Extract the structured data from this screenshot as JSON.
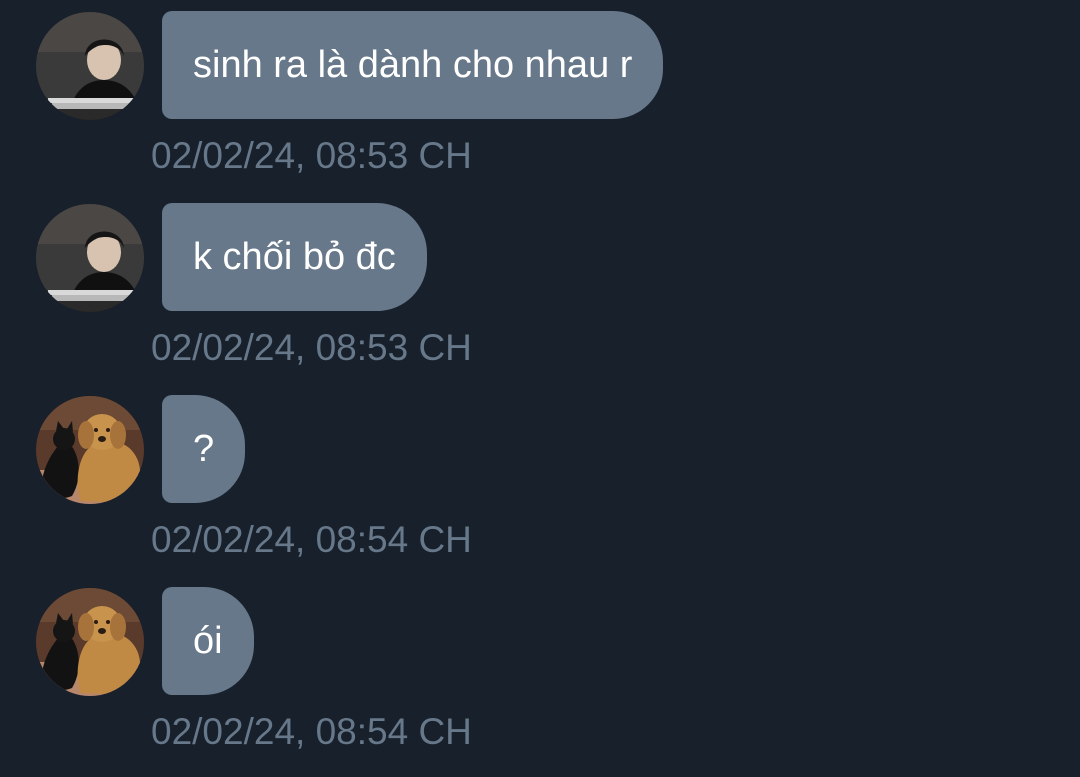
{
  "conversation": {
    "messages": [
      {
        "sender_avatar": "person-at-desk-avatar",
        "text": "sinh ra là dành cho nhau r",
        "timestamp": "02/02/24, 08:53 CH"
      },
      {
        "sender_avatar": "person-at-desk-avatar",
        "text": "k chối bỏ đc",
        "timestamp": "02/02/24, 08:53 CH"
      },
      {
        "sender_avatar": "cat-and-dog-avatar",
        "text": "?",
        "timestamp": "02/02/24, 08:54 CH"
      },
      {
        "sender_avatar": "cat-and-dog-avatar",
        "text": "ói",
        "timestamp": "02/02/24, 08:54 CH"
      }
    ]
  },
  "colors": {
    "background": "#18202b",
    "bubble": "#66788a",
    "bubble_text": "#ffffff",
    "timestamp": "#66788a"
  }
}
